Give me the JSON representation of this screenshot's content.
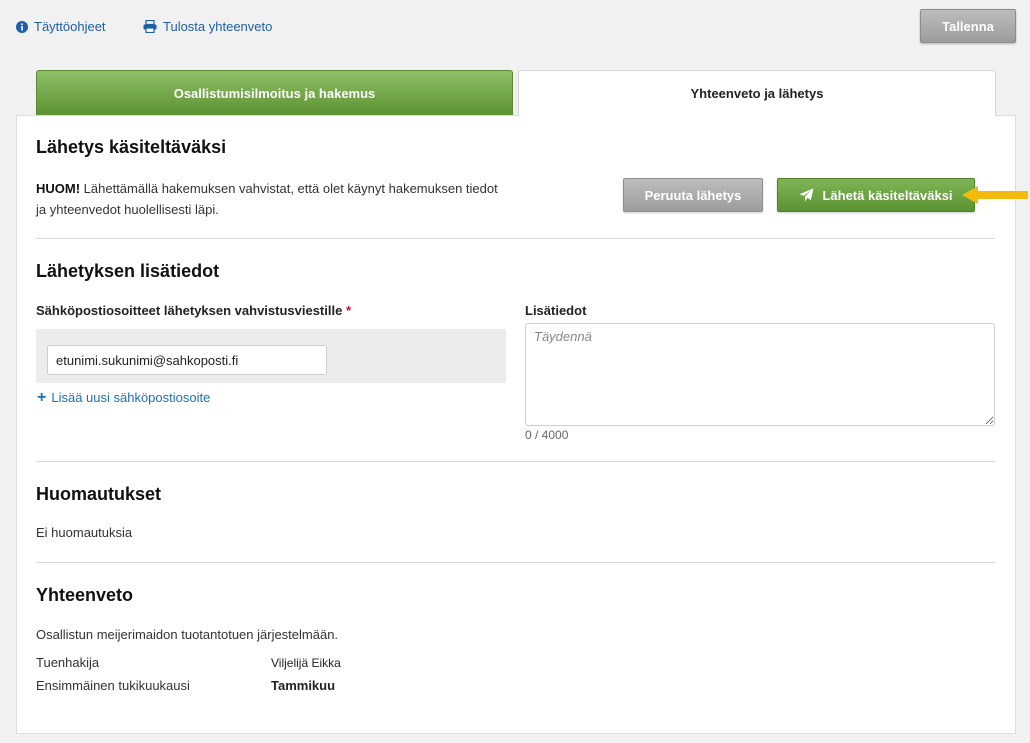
{
  "toolbar": {
    "help_link": "Täyttöohjeet",
    "print_link": "Tulosta yhteenveto",
    "save_label": "Tallenna"
  },
  "tabs": [
    {
      "label": "Osallistumisilmoitus ja hakemus",
      "active": false
    },
    {
      "label": "Yhteenveto ja lähetys",
      "active": true
    }
  ],
  "send_section": {
    "title": "Lähetys käsiteltäväksi",
    "note_strong": "HUOM!",
    "note_text": " Lähettämällä hakemuksen vahvistat, että olet käynyt hakemuksen tiedot ja yhteenvedot huolellisesti läpi.",
    "cancel_label": "Peruuta lähetys",
    "send_label": "Lähetä käsiteltäväksi"
  },
  "extra_section": {
    "title": "Lähetyksen lisätiedot",
    "email_label": "Sähköpostiosoitteet lähetyksen vahvistusviestille",
    "required_mark": "*",
    "email_value": "etunimi.sukunimi@sahkoposti.fi",
    "add_email_label": "Lisää uusi sähköpostiosoite",
    "extra_label": "Lisätiedot",
    "extra_placeholder": "Täydennä",
    "char_counter": "0 / 4000"
  },
  "remarks_section": {
    "title": "Huomautukset",
    "text": "Ei huomautuksia"
  },
  "summary_section": {
    "title": "Yhteenveto",
    "text": "Osallistun meijerimaidon tuotantotuen järjestelmään.",
    "rows": [
      {
        "key": "Tuenhakija",
        "value": "Viljelijä Eikka"
      },
      {
        "key": "Ensimmäinen tukikuukausi",
        "value": "Tammikuu"
      }
    ]
  },
  "colors": {
    "accent_green": "#5c9331",
    "link_blue": "#1f5fa6",
    "arrow_yellow": "#f2b90f"
  }
}
